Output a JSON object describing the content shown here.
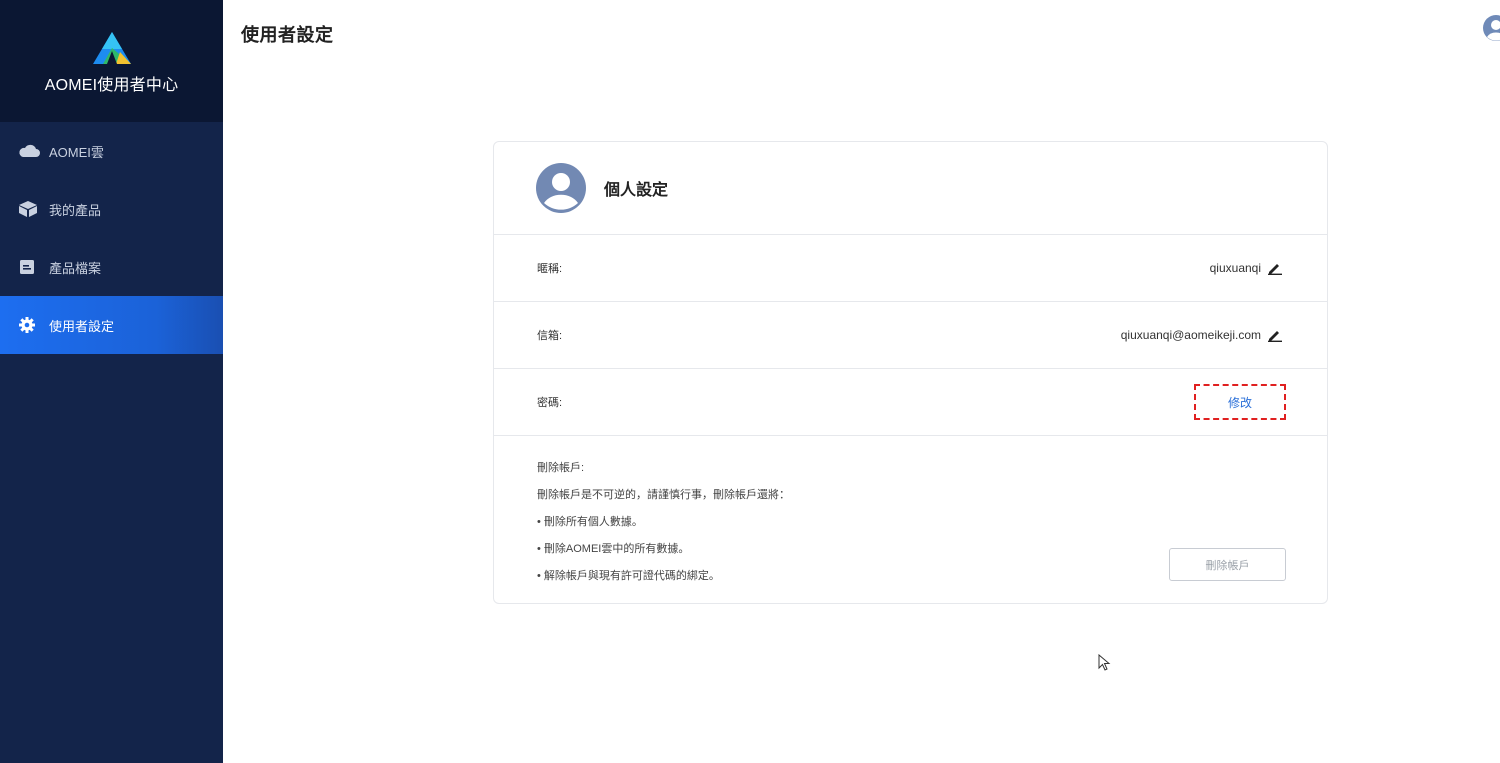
{
  "brand": {
    "name": "AOMEI使用者中心"
  },
  "sidebar": {
    "items": [
      {
        "label": "AOMEI雲",
        "icon": "cloud-icon"
      },
      {
        "label": "我的產品",
        "icon": "box-icon"
      },
      {
        "label": "產品檔案",
        "icon": "file-icon"
      },
      {
        "label": "使用者設定",
        "icon": "gear-icon"
      }
    ]
  },
  "header": {
    "title": "使用者設定"
  },
  "card": {
    "title": "個人設定",
    "nickname": {
      "label": "暱稱:",
      "value": "qiuxuanqi"
    },
    "email": {
      "label": "信箱:",
      "value": "qiuxuanqi@aomeikeji.com"
    },
    "password": {
      "label": "密碼:",
      "action": "修改"
    },
    "delete": {
      "heading": "刪除帳戶:",
      "warning": "刪除帳戶是不可逆的，請謹慎行事，刪除帳戶還將：",
      "items": [
        "• 刪除所有個人數據。",
        "• 刪除AOMEI雲中的所有數據。",
        "• 解除帳戶與現有許可證代碼的綁定。"
      ],
      "button": "刪除帳戶"
    }
  },
  "colors": {
    "sidebar": "#13244a",
    "active": "#1d6ef0",
    "link": "#2a6fd8",
    "highlight": "#e02020"
  }
}
